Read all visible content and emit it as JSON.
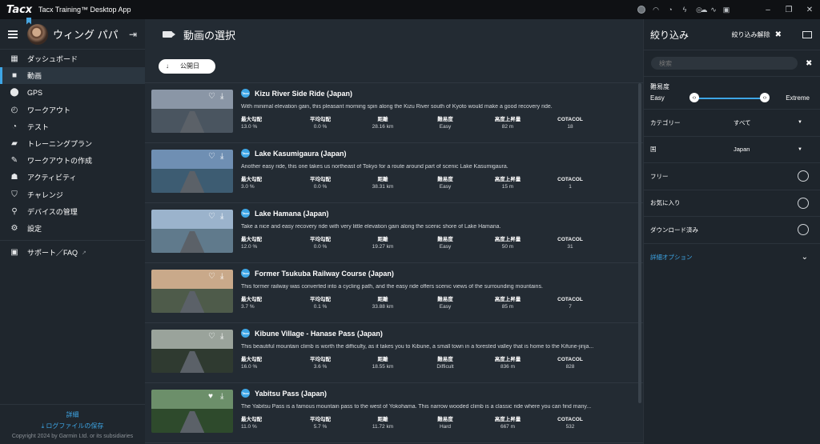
{
  "titlebar": {
    "brand": "Tacx",
    "app_title": "Tacx Training™ Desktop App"
  },
  "user": {
    "name": "ウィング パパ"
  },
  "nav": [
    {
      "label": "ダッシュボード",
      "icon": "dashboard-icon",
      "glyph": "▦"
    },
    {
      "label": "動画",
      "icon": "video-icon",
      "glyph": "■",
      "active": true
    },
    {
      "label": "GPS",
      "icon": "location-pin-icon",
      "glyph": "⬤"
    },
    {
      "label": "ワークアウト",
      "icon": "stopwatch-icon",
      "glyph": "◴"
    },
    {
      "label": "テスト",
      "icon": "gauge-icon",
      "glyph": "◔"
    },
    {
      "label": "トレーニングプラン",
      "icon": "book-icon",
      "glyph": "▰"
    },
    {
      "label": "ワークアウトの作成",
      "icon": "pencil-icon",
      "glyph": "✎"
    },
    {
      "label": "アクティビティ",
      "icon": "people-icon",
      "glyph": "☗"
    },
    {
      "label": "チャレンジ",
      "icon": "shield-icon",
      "glyph": "⛉"
    },
    {
      "label": "デバイスの管理",
      "icon": "wrench-icon",
      "glyph": "⚲"
    },
    {
      "label": "設定",
      "icon": "gears-icon",
      "glyph": "⚙"
    }
  ],
  "support": {
    "label": "サポート／FAQ"
  },
  "footer": {
    "details": "詳細",
    "save_log": "ログファイルの保存",
    "copyright": "Copyright 2024 by Garmin Ltd. or its subsidiaries"
  },
  "main": {
    "title": "動画の選択",
    "sort_label": "公開日"
  },
  "stat_headers": [
    "最大勾配",
    "平均勾配",
    "距離",
    "難易度",
    "高度上昇量",
    "COTACOL"
  ],
  "videos": [
    {
      "title": "Kizu River Side Ride (Japan)",
      "desc": "With minimal elevation gain, this pleasant morning spin along the Kizu River south of Kyoto would make a good recovery ride.",
      "stats": [
        "13.0 %",
        "0.0 %",
        "28.16 km",
        "Easy",
        "82 m",
        "18"
      ],
      "sky": "#8a96a6",
      "land": "#4a5560",
      "favorite": false
    },
    {
      "title": "Lake Kasumigaura (Japan)",
      "desc": "Another easy ride, this one takes us northeast of Tokyo for a route around part of scenic Lake Kasumigaura.",
      "stats": [
        "3.0 %",
        "0.0 %",
        "38.31 km",
        "Easy",
        "15 m",
        "1"
      ],
      "sky": "#6f8fb3",
      "land": "#3d5c72",
      "favorite": false
    },
    {
      "title": "Lake Hamana (Japan)",
      "desc": "Take a nice and easy recovery ride with very little elevation gain along the scenic shore of Lake Hamana.",
      "stats": [
        "12.0 %",
        "0.0 %",
        "19.27 km",
        "Easy",
        "50 m",
        "31"
      ],
      "sky": "#9bb3cc",
      "land": "#607a8c",
      "favorite": false
    },
    {
      "title": "Former Tsukuba Railway Course (Japan)",
      "desc": "This former railway was converted into a cycling path, and the easy ride offers scenic views of the surrounding mountains.",
      "stats": [
        "3.7 %",
        "0.1 %",
        "33.88 km",
        "Easy",
        "85 m",
        "7"
      ],
      "sky": "#c9a98a",
      "land": "#4e5b4a",
      "favorite": false
    },
    {
      "title": "Kibune Village - Hanase Pass (Japan)",
      "desc": "This beautiful mountain climb is worth the difficulty, as it takes you to Kibune, a small town in a forested valley that is home to the Kifune-jinja...",
      "stats": [
        "16.0 %",
        "3.6 %",
        "18.55 km",
        "Difficult",
        "836 m",
        "828"
      ],
      "sky": "#9aa39b",
      "land": "#2f3a30",
      "favorite": false
    },
    {
      "title": "Yabitsu Pass (Japan)",
      "desc": "The Yabitsu Pass is a famous mountain pass to the west of Yokohama. This narrow wooded climb is a classic ride where you can find many...",
      "stats": [
        "11.0 %",
        "5.7 %",
        "11.72 km",
        "Hard",
        "667 m",
        "532"
      ],
      "sky": "#6c8f6a",
      "land": "#2e4a2c",
      "favorite": true
    }
  ],
  "filter": {
    "title": "絞り込み",
    "clear": "絞り込み解除",
    "search_placeholder": "検索",
    "difficulty": {
      "label": "難易度",
      "min": "Easy",
      "max": "Extreme"
    },
    "category": {
      "label": "カテゴリー",
      "value": "すべて"
    },
    "country": {
      "label": "国",
      "value": "Japan"
    },
    "free": "フリー",
    "favorites": "お気に入り",
    "downloaded": "ダウンロード済み",
    "advanced": "詳細オプション"
  },
  "colors": {
    "accent": "#3ea6e6",
    "sidebar": "#1f262d",
    "main": "#232b33"
  }
}
